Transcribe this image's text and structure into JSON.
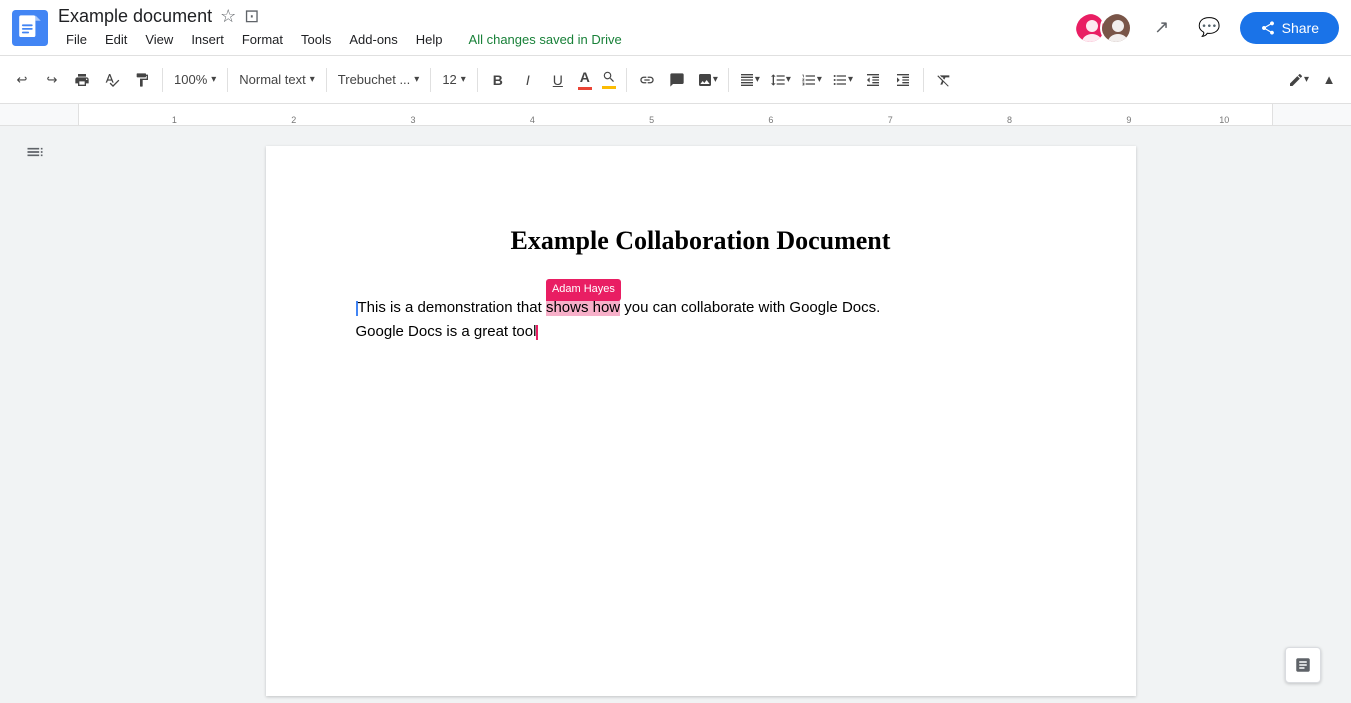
{
  "titleBar": {
    "docTitle": "Example document",
    "saveStatus": "All changes saved in Drive",
    "shareLabel": "Share",
    "menuItems": [
      "File",
      "Edit",
      "View",
      "Insert",
      "Format",
      "Tools",
      "Add-ons",
      "Help"
    ]
  },
  "toolbar": {
    "zoomLevel": "100%",
    "textStyle": "Normal text",
    "fontFamily": "Trebuchet ...",
    "fontSize": "12",
    "boldLabel": "B",
    "italicLabel": "I",
    "underlineLabel": "U"
  },
  "document": {
    "heading": "Example Collaboration Document",
    "body": {
      "line1_before": "This is a demonstration that ",
      "line1_highlighted": "shows how",
      "line1_after": " you can collaborate with Google Docs.",
      "line2": "Google Docs is a great tool",
      "collaboratorName": "Adam Hayes"
    }
  },
  "icons": {
    "undo": "↩",
    "redo": "↪",
    "print": "🖨",
    "spellcheck": "✓",
    "paintFormat": "🪣",
    "chevronDown": "▾",
    "bold": "B",
    "italic": "I",
    "underline": "U",
    "link": "🔗",
    "insertImage": "⊞",
    "imageMenu": "🖼",
    "align": "≡",
    "lineSpacing": "↕",
    "numberedList": "1.",
    "bulletList": "•",
    "indent": "→",
    "outdent": "←",
    "clearFormatting": "✗",
    "editingMode": "✏",
    "collapse": "▲",
    "star": "☆",
    "drive": "⊡",
    "share": "👤",
    "activity": "↗",
    "comments": "💬",
    "outline": "☰",
    "explore": "+"
  }
}
